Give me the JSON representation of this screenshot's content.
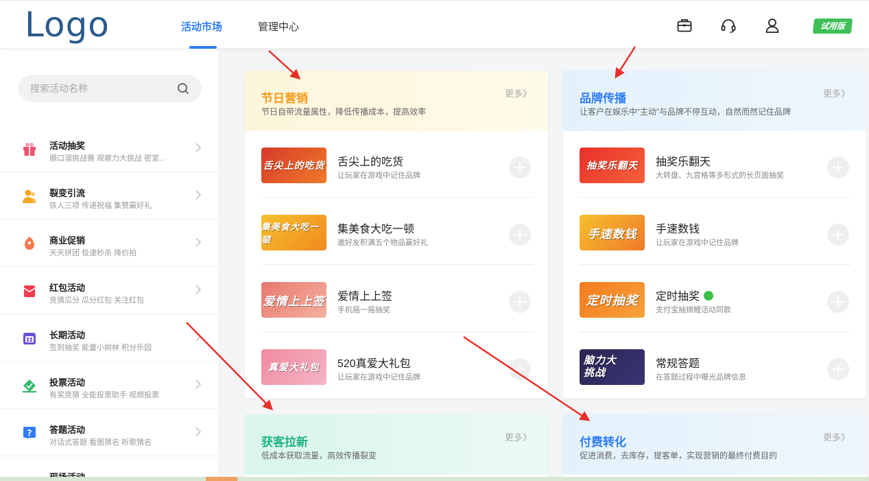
{
  "header": {
    "logo": "Logo",
    "tabs": [
      {
        "label": "活动市场",
        "active": true
      },
      {
        "label": "管理中心",
        "active": false
      }
    ],
    "icons": [
      "briefcase-icon",
      "headset-icon",
      "user-icon"
    ],
    "trial_badge": "试用版"
  },
  "sidebar": {
    "search_placeholder": "搜索活动名称",
    "categories": [
      {
        "title": "活动抽奖",
        "sub": "順口溜挑战赛  观察力大挑战  密室...",
        "icon": "gift-icon",
        "color": "#f0506e"
      },
      {
        "title": "裂变引流",
        "sub": "铁人三项  传递祝福  集赞赢好礼",
        "icon": "users-icon",
        "color": "#f5a623"
      },
      {
        "title": "商业促销",
        "sub": "天天拼团  极速秒杀  降价拍",
        "icon": "tag-icon",
        "color": "#f5794e"
      },
      {
        "title": "红包活动",
        "sub": "竞猜瓜分  瓜分红包  关注红包",
        "icon": "red-envelope-icon",
        "color": "#f03e4e"
      },
      {
        "title": "长期活动",
        "sub": "签到抽奖  能量小树林  积分乐园",
        "icon": "calendar-icon",
        "color": "#6a4fd8"
      },
      {
        "title": "投票活动",
        "sub": "有奖竞猜  全能投票助手  视频投票",
        "icon": "vote-icon",
        "color": "#2fb96a"
      },
      {
        "title": "答题活动",
        "sub": "对话式答题  看图猜名  听歌猜名",
        "icon": "question-icon",
        "color": "#2f7cf6"
      },
      {
        "title": "现场活动",
        "sub": "",
        "icon": "stage-icon",
        "color": "#f0506e"
      }
    ]
  },
  "cards": {
    "festival": {
      "title": "节日营销",
      "desc": "节日自带流量属性，降低传播成本，提高效率",
      "more": "更多》",
      "items": [
        {
          "title": "舌尖上的吃货",
          "desc": "让玩家在游戏中记住品牌",
          "thumb": "舌尖上的吃货"
        },
        {
          "title": "集美食大吃一顿",
          "desc": "邀好友积满五个物品赢好礼",
          "thumb": "集美食大吃一顿"
        },
        {
          "title": "爱情上上签",
          "desc": "手机摇一摇抽奖",
          "thumb": "爱情上上签"
        },
        {
          "title": "520真爱大礼包",
          "desc": "让玩家在游戏中记住品牌",
          "thumb": "真爱大礼包"
        }
      ]
    },
    "brand": {
      "title": "品牌传播",
      "desc": "让客户在娱乐中“主动”与品牌不停互动，自然而然记住品牌",
      "more": "更多》",
      "items": [
        {
          "title": "抽奖乐翻天",
          "desc": "大转盘、九宫格等多形式的长页面抽奖",
          "thumb": "抽奖乐翻天"
        },
        {
          "title": "手速数钱",
          "desc": "让玩家在游戏中记住品牌",
          "thumb": "手速数钱"
        },
        {
          "title": "定时抽奖",
          "desc": "支付宝抽锦鲤活动同款",
          "thumb": "定时抽奖"
        },
        {
          "title": "常规答题",
          "desc": "在答题过程中曝光品牌信息",
          "thumb": "脑力大挑战"
        }
      ]
    },
    "acquire": {
      "title": "获客拉新",
      "desc": "低成本获取流量，高效传播裂变",
      "more": "更多》"
    },
    "paid": {
      "title": "付费转化",
      "desc": "促进消费，去库存，提客单，实现营销的最终付费目的",
      "more": "更多》"
    }
  }
}
